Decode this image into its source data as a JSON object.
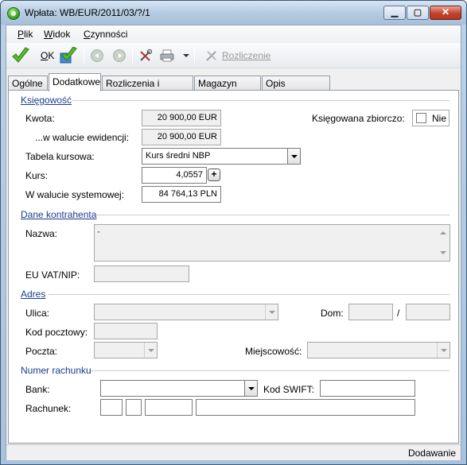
{
  "window": {
    "title": "Wpłata: WB/EUR/2011/03/?/1",
    "minimize_glyph": "▁",
    "maximize_glyph": "▢",
    "close_glyph": "✕"
  },
  "menu": {
    "items": [
      {
        "label": "Plik",
        "underline": "P",
        "rest": "lik"
      },
      {
        "label": "Widok",
        "underline": "W",
        "rest": "idok"
      },
      {
        "label": "Czynności",
        "underline": "C",
        "rest": "zynności"
      }
    ]
  },
  "toolbar": {
    "ok_label": "OK",
    "ok_underline": "O",
    "ok_rest": "K",
    "settle_label": "Rozliczenie",
    "icons": [
      "ok-check-icon",
      "ok-save-check-icon",
      "back-icon",
      "forward-icon",
      "tools-icon",
      "print-icon",
      "dropdown-arrow-icon",
      "settle-icon"
    ]
  },
  "tabs": [
    {
      "label": "Ogólne",
      "active": false
    },
    {
      "label": "Dodatkowe",
      "active": true
    },
    {
      "label": "Rozliczenia i Przelewy",
      "active": false
    },
    {
      "label": "Magazyn walut",
      "active": false
    },
    {
      "label": "Opis analityczny",
      "active": false
    }
  ],
  "ksiegowosc": {
    "heading": "Księgowość",
    "kwota_label": "Kwota:",
    "kwota_value": "20 900,00 EUR",
    "waluta_ewid_label": "...w walucie ewidencji:",
    "waluta_ewid_value": "20 900,00 EUR",
    "tabela_label": "Tabela kursowa:",
    "tabela_value": "Kurs średni NBP",
    "kurs_label": "Kurs:",
    "kurs_value": "4,0557",
    "kurs_spin": "+",
    "systemowa_label": "W walucie systemowej:",
    "systemowa_value": "84 764,13 PLN",
    "zbiorczo_label": "Księgowana zbiorczo:",
    "zbiorczo_value": "Nie"
  },
  "kontrahent": {
    "heading": "Dane kontrahenta",
    "nazwa_label": "Nazwa:",
    "nazwa_value": "·",
    "vat_label": "EU VAT/NIP:",
    "vat_value": ""
  },
  "adres": {
    "heading": "Adres",
    "ulica_label": "Ulica:",
    "ulica_value": "",
    "dom_label": "Dom:",
    "dom_value": "",
    "separator": "/",
    "lokal_value": "",
    "kod_label": "Kod pocztowy:",
    "kod_value": "",
    "poczta_label": "Poczta:",
    "poczta_value": "",
    "miejscowosc_label": "Miejscowość:",
    "miejscowosc_value": ""
  },
  "rachunek": {
    "heading": "Numer rachunku",
    "bank_label": "Bank:",
    "bank_value": "",
    "swift_label": "Kod SWIFT:",
    "swift_value": "",
    "rachunek_label": "Rachunek:"
  },
  "status": {
    "mode": "Dodawanie"
  }
}
